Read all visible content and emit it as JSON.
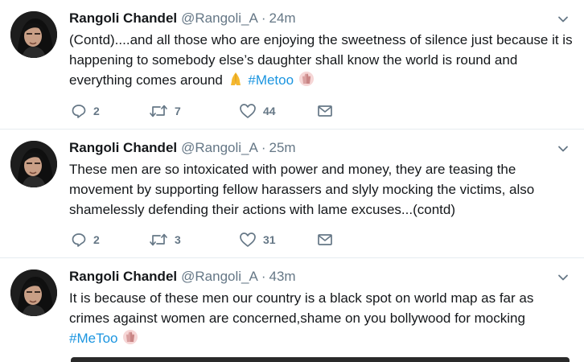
{
  "tweets": [
    {
      "name": "Rangoli Chandel",
      "handle": "@Rangoli_A",
      "dot": "·",
      "time": "24m",
      "text_before": "(Contd)....and all those who are enjoying the sweetness of silence just because it is happening to somebody else’s daughter shall know the world is round and everything comes around",
      "hashtag": "#Metoo",
      "text_after": "",
      "emojis": [
        "folded-hands-emoji",
        "raised-hands-emoji"
      ],
      "replies": "2",
      "retweets": "7",
      "likes": "44"
    },
    {
      "name": "Rangoli Chandel",
      "handle": "@Rangoli_A",
      "dot": "·",
      "time": "25m",
      "text_before": "These men are so intoxicated with power and money, they are teasing the movement by supporting fellow harassers and slyly mocking the victims, also shamelessly defending their actions with lame excuses...(contd)",
      "hashtag": "",
      "text_after": "",
      "replies": "2",
      "retweets": "3",
      "likes": "31"
    },
    {
      "name": "Rangoli Chandel",
      "handle": "@Rangoli_A",
      "dot": "·",
      "time": "43m",
      "text_before": "It is because of these men our country is a black spot on world map as far as crimes against women are concerned,shame on you bollywood for mocking",
      "hashtag": "#MeToo",
      "text_after": ""
    }
  ],
  "icons": {
    "reply": "reply-icon",
    "retweet": "retweet-icon",
    "like": "heart-icon",
    "dm": "envelope-icon",
    "caret": "chevron-down-icon"
  },
  "colors": {
    "name": "#14171a",
    "muted": "#657786",
    "hashtag": "#1b95e0",
    "divider": "#e6ecf0"
  }
}
